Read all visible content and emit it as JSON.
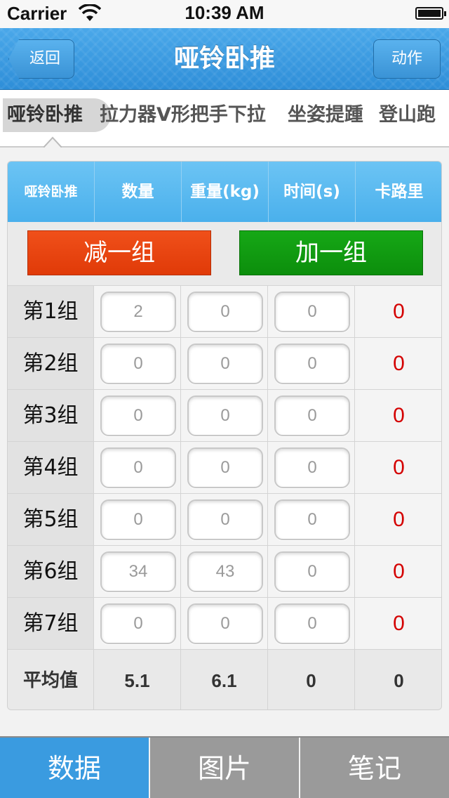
{
  "status_bar": {
    "carrier": "Carrier",
    "time": "10:39 AM"
  },
  "nav": {
    "back_label": "返回",
    "title": "哑铃卧推",
    "action_label": "动作"
  },
  "categories": [
    {
      "label": "哑铃卧推",
      "selected": true
    },
    {
      "label": "拉力器V形把手下拉",
      "selected": false
    },
    {
      "label": "坐姿提踵",
      "selected": false
    },
    {
      "label": "登山跑",
      "selected": false
    }
  ],
  "table": {
    "headers": [
      "哑铃卧推",
      "数量",
      "重量(kg)",
      "时间(s)",
      "卡路里"
    ],
    "minus_label": "减一组",
    "plus_label": "加一组",
    "rows": [
      {
        "label": "第1组",
        "count": "2",
        "weight": "0",
        "time": "0",
        "calories": "0"
      },
      {
        "label": "第2组",
        "count": "0",
        "weight": "0",
        "time": "0",
        "calories": "0"
      },
      {
        "label": "第3组",
        "count": "0",
        "weight": "0",
        "time": "0",
        "calories": "0"
      },
      {
        "label": "第4组",
        "count": "0",
        "weight": "0",
        "time": "0",
        "calories": "0"
      },
      {
        "label": "第5组",
        "count": "0",
        "weight": "0",
        "time": "0",
        "calories": "0"
      },
      {
        "label": "第6组",
        "count": "34",
        "weight": "43",
        "time": "0",
        "calories": "0"
      },
      {
        "label": "第7组",
        "count": "0",
        "weight": "0",
        "time": "0",
        "calories": "0"
      }
    ],
    "average": {
      "label": "平均值",
      "count": "5.1",
      "weight": "6.1",
      "time": "0",
      "calories": "0"
    }
  },
  "tabs": [
    {
      "label": "数据",
      "active": true
    },
    {
      "label": "图片",
      "active": false
    },
    {
      "label": "笔记",
      "active": false
    }
  ],
  "colors": {
    "accent": "#3a9be0",
    "minus": "#e8420f",
    "plus": "#0e9a0e",
    "calorie": "#d40000"
  }
}
